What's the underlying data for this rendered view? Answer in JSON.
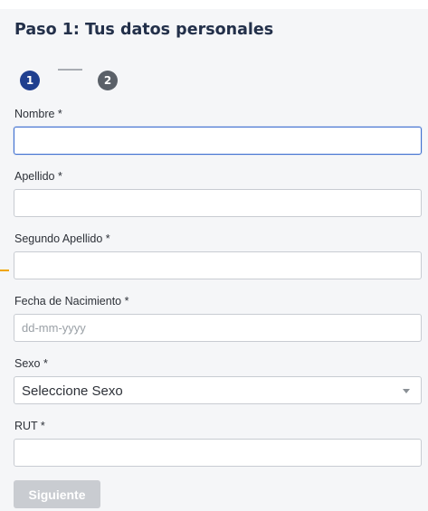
{
  "form": {
    "title": "Paso 1: Tus datos personales",
    "stepper": {
      "steps": [
        {
          "number": "1",
          "state": "active"
        },
        {
          "number": "2",
          "state": "inactive"
        }
      ]
    },
    "fields": {
      "nombre": {
        "label": "Nombre *",
        "value": "",
        "placeholder": ""
      },
      "apellido": {
        "label": "Apellido *",
        "value": "",
        "placeholder": ""
      },
      "segundo_apellido": {
        "label": "Segundo Apellido *",
        "value": "",
        "placeholder": ""
      },
      "fecha_nacimiento": {
        "label": "Fecha de Nacimiento *",
        "value": "",
        "placeholder": "dd-mm-yyyy"
      },
      "sexo": {
        "label": "Sexo *",
        "selected": "Seleccione Sexo"
      },
      "rut": {
        "label": "RUT *",
        "value": "",
        "placeholder": ""
      }
    },
    "next_button_label": "Siguiente"
  },
  "colors": {
    "step_active": "#1f3f8f",
    "step_inactive": "#5a6068",
    "focus_border": "#3f6fd0",
    "disabled_button": "#c9ccd1"
  }
}
